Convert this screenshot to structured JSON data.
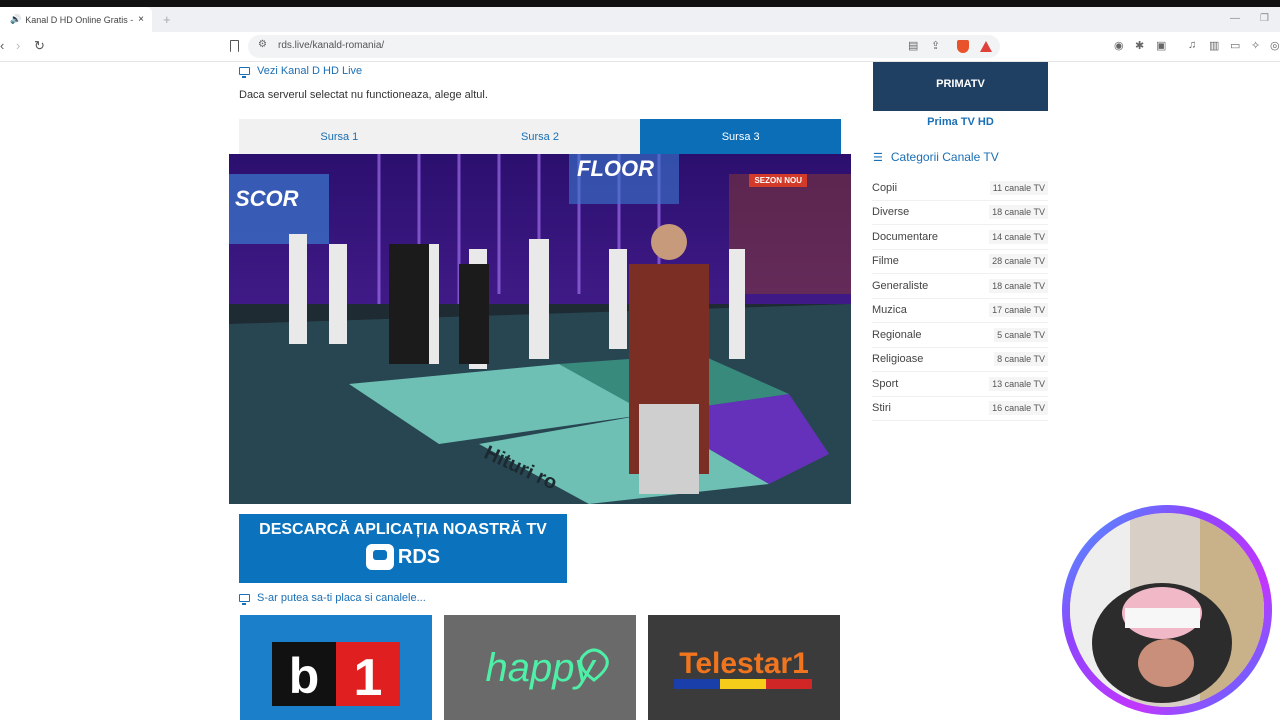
{
  "browser": {
    "tab_title": "Kanal D HD Online Gratis - RD",
    "tab_close": "×",
    "new_tab": "+",
    "url": "rds.live/kanald-romania/"
  },
  "page": {
    "section_title": "Vezi Kanal D HD Live",
    "server_note": "Daca serverul selectat nu functioneaza, alege altul.",
    "sources": [
      {
        "label": "Sursa 1",
        "active": false
      },
      {
        "label": "Sursa 2",
        "active": false
      },
      {
        "label": "Sursa 3",
        "active": true
      }
    ],
    "video": {
      "badge": "SEZON NOU",
      "floor_text": "Hituri ro"
    },
    "banner": {
      "line1": "DESCARCĂ APLICAȚIA NOASTRĂ TV",
      "brand": "RDS"
    },
    "suggest_title": "S-ar putea sa-ti placa si canalele...",
    "thumbs": [
      {
        "name": "b1",
        "text": "b1"
      },
      {
        "name": "happy",
        "text": "happy"
      },
      {
        "name": "telestar1",
        "text": "Telestar1"
      }
    ]
  },
  "sidebar": {
    "prima": {
      "logo": "PRIMATV",
      "caption": "Prima TV HD"
    },
    "categories_title": "Categorii Canale TV",
    "categories": [
      {
        "name": "Copii",
        "count": "11 canale TV"
      },
      {
        "name": "Diverse",
        "count": "18 canale TV"
      },
      {
        "name": "Documentare",
        "count": "14 canale TV"
      },
      {
        "name": "Filme",
        "count": "28 canale TV"
      },
      {
        "name": "Generaliste",
        "count": "18 canale TV"
      },
      {
        "name": "Muzica",
        "count": "17 canale TV"
      },
      {
        "name": "Regionale",
        "count": "5 canale TV"
      },
      {
        "name": "Religioase",
        "count": "8 canale TV"
      },
      {
        "name": "Sport",
        "count": "13 canale TV"
      },
      {
        "name": "Stiri",
        "count": "16 canale TV"
      }
    ]
  },
  "colors": {
    "accent": "#1a6fb5",
    "active_tab": "#0b6eb6",
    "banner": "#0b72bd",
    "badge": "#d23a2a"
  }
}
